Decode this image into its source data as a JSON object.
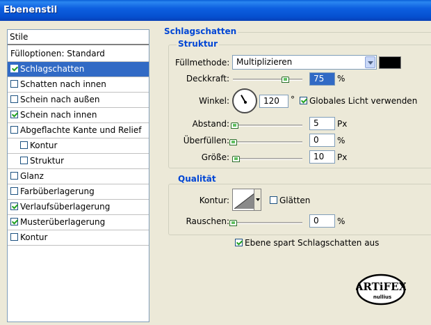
{
  "window": {
    "title": "Ebenenstil"
  },
  "styles_panel": {
    "header": "Stile",
    "items": [
      {
        "label": "Fülloptionen: Standard",
        "checkbox": false,
        "checked": false,
        "sub": false,
        "active": false
      },
      {
        "label": "Schlagschatten",
        "checkbox": true,
        "checked": true,
        "sub": false,
        "active": true
      },
      {
        "label": "Schatten nach innen",
        "checkbox": true,
        "checked": false,
        "sub": false,
        "active": false
      },
      {
        "label": "Schein nach außen",
        "checkbox": true,
        "checked": false,
        "sub": false,
        "active": false
      },
      {
        "label": "Schein nach innen",
        "checkbox": true,
        "checked": true,
        "sub": false,
        "active": false
      },
      {
        "label": "Abgeflachte Kante und Relief",
        "checkbox": true,
        "checked": false,
        "sub": false,
        "active": false
      },
      {
        "label": "Kontur",
        "checkbox": true,
        "checked": false,
        "sub": true,
        "active": false
      },
      {
        "label": "Struktur",
        "checkbox": true,
        "checked": false,
        "sub": true,
        "active": false
      },
      {
        "label": "Glanz",
        "checkbox": true,
        "checked": false,
        "sub": false,
        "active": false
      },
      {
        "label": "Farbüberlagerung",
        "checkbox": true,
        "checked": false,
        "sub": false,
        "active": false
      },
      {
        "label": "Verlaufsüberlagerung",
        "checkbox": true,
        "checked": true,
        "sub": false,
        "active": false
      },
      {
        "label": "Musterüberlagerung",
        "checkbox": true,
        "checked": true,
        "sub": false,
        "active": false
      },
      {
        "label": "Kontur",
        "checkbox": true,
        "checked": false,
        "sub": false,
        "active": false
      }
    ]
  },
  "drop_shadow": {
    "title": "Schlagschatten",
    "structure": {
      "title": "Struktur",
      "blend_mode_label": "Füllmethode:",
      "blend_mode_value": "Multiplizieren",
      "shadow_color": "#000000",
      "opacity_label": "Deckkraft:",
      "opacity_value": "75",
      "opacity_unit": "%",
      "opacity_slider": 0.75,
      "angle_label": "Winkel:",
      "angle_value": "120",
      "angle_unit": "°",
      "global_light_label": "Globales Licht verwenden",
      "global_light_checked": true,
      "distance_label": "Abstand:",
      "distance_value": "5",
      "distance_unit": "Px",
      "distance_slider": 0.02,
      "spread_label": "Überfüllen:",
      "spread_value": "0",
      "spread_unit": "%",
      "spread_slider": 0.0,
      "size_label": "Größe:",
      "size_value": "10",
      "size_unit": "Px",
      "size_slider": 0.04
    },
    "quality": {
      "title": "Qualität",
      "contour_label": "Kontur:",
      "antialias_label": "Glätten",
      "antialias_checked": false,
      "noise_label": "Rauschen:",
      "noise_value": "0",
      "noise_unit": "%",
      "noise_slider": 0.0
    },
    "knockout_label": "Ebene spart Schlagschatten aus",
    "knockout_checked": true
  },
  "logo": {
    "text": "ARTiFEX",
    "subtext": "nullius"
  },
  "colors": {
    "accent": "#316ac5",
    "section_title": "#0046d5",
    "dialog_bg": "#ece9d8",
    "titlebar": "#0a5fd8"
  }
}
